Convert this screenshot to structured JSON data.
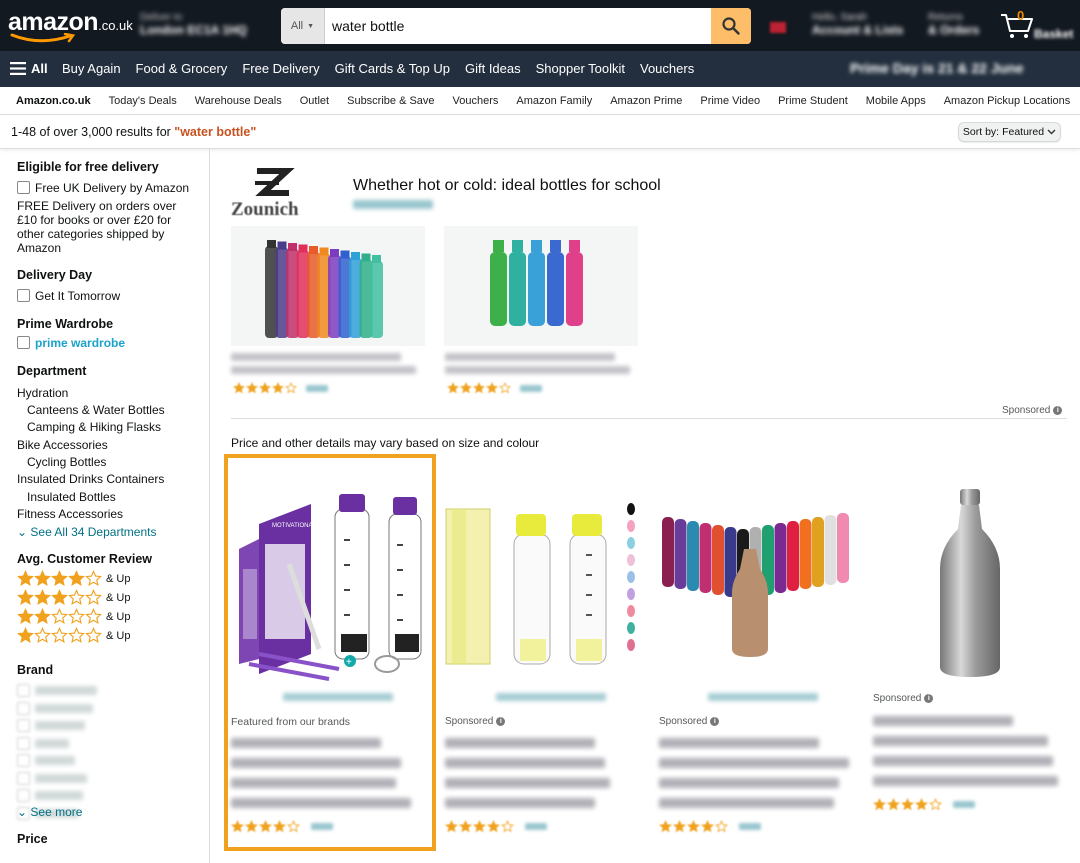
{
  "header": {
    "logo_word": "amazon",
    "logo_tld": ".co.uk",
    "deliver_line1": "Deliver to",
    "deliver_line2": "London EC1A 1HQ",
    "search": {
      "category": "All",
      "query": "water bottle"
    },
    "account_line1": "Hello, Sarah",
    "account_line2": "Account & Lists",
    "orders_line1": "Returns",
    "orders_line2": "& Orders",
    "cart_count": "0",
    "cart_label": "Basket"
  },
  "nav": {
    "all_label": "All",
    "items": [
      "Buy Again",
      "Food & Grocery",
      "Free Delivery",
      "Gift Cards & Top Up",
      "Gift Ideas",
      "Shopper Toolkit",
      "Vouchers"
    ],
    "promo": "Prime Day is 21 & 22 June"
  },
  "subnav": {
    "items": [
      "Amazon.co.uk",
      "Today's Deals",
      "Warehouse Deals",
      "Outlet",
      "Subscribe & Save",
      "Vouchers",
      "Amazon Family",
      "Amazon Prime",
      "Prime Video",
      "Prime Student",
      "Mobile Apps",
      "Amazon Pickup Locations"
    ]
  },
  "results": {
    "count_text": "1-48 of over 3,000 results for ",
    "query_text": "\"water bottle\"",
    "sort_label": "Sort by:",
    "sort_value": "Featured"
  },
  "sidebar": {
    "free_delivery_heading": "Eligible for free delivery",
    "free_uk_delivery": "Free UK Delivery by Amazon",
    "free_delivery_note": [
      "FREE Delivery on orders over",
      "£10 for books or over £20 for",
      "other categories shipped by",
      "Amazon"
    ],
    "delivery_day_heading": "Delivery Day",
    "get_it_tomorrow": "Get It Tomorrow",
    "prime_wardrobe_heading": "Prime Wardrobe",
    "prime_wardrobe_link": "prime wardrobe",
    "department_heading": "Department",
    "departments": [
      {
        "label": "Hydration",
        "level": 0
      },
      {
        "label": "Canteens & Water Bottles",
        "level": 1
      },
      {
        "label": "Camping & Hiking Flasks",
        "level": 1
      },
      {
        "label": "Bike Accessories",
        "level": 0
      },
      {
        "label": "Cycling Bottles",
        "level": 1
      },
      {
        "label": "Insulated Drinks Containers",
        "level": 0
      },
      {
        "label": "Insulated Bottles",
        "level": 1
      },
      {
        "label": "Fitness Accessories",
        "level": 0
      }
    ],
    "see_all_departments": "See All 34 Departments",
    "review_heading": "Avg. Customer Review",
    "review_rows": [
      {
        "stars": 4,
        "label": "& Up"
      },
      {
        "stars": 3,
        "label": "& Up"
      },
      {
        "stars": 2,
        "label": "& Up"
      },
      {
        "stars": 1,
        "label": "& Up"
      }
    ],
    "brand_heading": "Brand",
    "see_more": "See more",
    "price_heading": "Price"
  },
  "sponsored_brand": {
    "logo_text": "Zounich",
    "headline": "Whether hot or cold: ideal bottles for school",
    "sponsored_label": "Sponsored"
  },
  "disclaimer": "Price and other details may vary based on size and colour",
  "products": [
    {
      "label": "Featured from our brands"
    },
    {
      "label": "Sponsored"
    },
    {
      "label": "Sponsored"
    },
    {
      "label": "Sponsored"
    }
  ],
  "colors": {
    "header_bg": "#131921",
    "nav_bg": "#232f3e",
    "search_button": "#febd69",
    "highlight_border": "#f0a21e",
    "star": "#f0a21e",
    "link": "#007185",
    "query": "#c7511f"
  }
}
